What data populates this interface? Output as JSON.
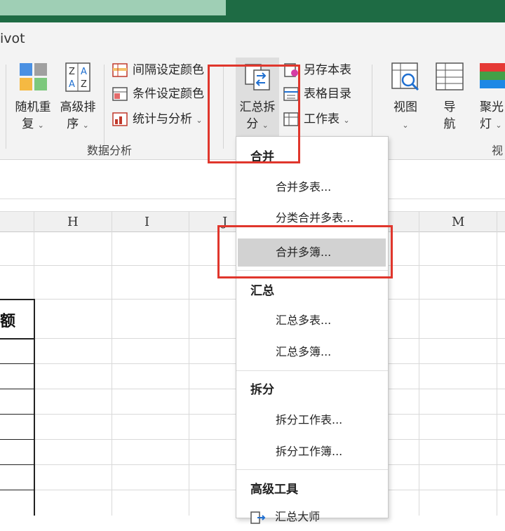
{
  "ribbon": {
    "tab_partial": "ivot",
    "buttons": {
      "random_repeat": [
        "随机重",
        "复"
      ],
      "advanced_sort": [
        "高级排",
        "序"
      ],
      "summary_split": [
        "汇总拆",
        "分"
      ],
      "view": [
        "视图",
        ""
      ],
      "navigate": [
        "导",
        "航"
      ],
      "spotlight": [
        "聚光",
        "灯"
      ]
    },
    "small_buttons": {
      "interval_color": "间隔设定颜色",
      "condition_color": "条件设定颜色",
      "stats_analysis": "统计与分析",
      "save_copy": "另存本表",
      "table_toc": "表格目录",
      "worksheet": "工作表"
    },
    "groups": {
      "data_analysis": "数据分析",
      "view_partial": "视"
    }
  },
  "sheet": {
    "columns": [
      "H",
      "I",
      "J",
      "M"
    ],
    "cell_partial": "额"
  },
  "menu": {
    "sections": {
      "merge": "合并",
      "summary": "汇总",
      "split": "拆分",
      "advanced": "高级工具"
    },
    "items": {
      "merge_sheets": "合并多表...",
      "category_merge": "分类合并多表...",
      "merge_workbooks": "合并多簿...",
      "summary_sheets": "汇总多表...",
      "summary_workbooks": "汇总多簿...",
      "split_worksheet": "拆分工作表...",
      "split_workbook": "拆分工作簿...",
      "cut_partial": "汇总大师"
    }
  },
  "colors": {
    "title_green": "#1e6b44",
    "highlight_red": "#e0362c",
    "menu_selected": "#d2d2d2"
  }
}
